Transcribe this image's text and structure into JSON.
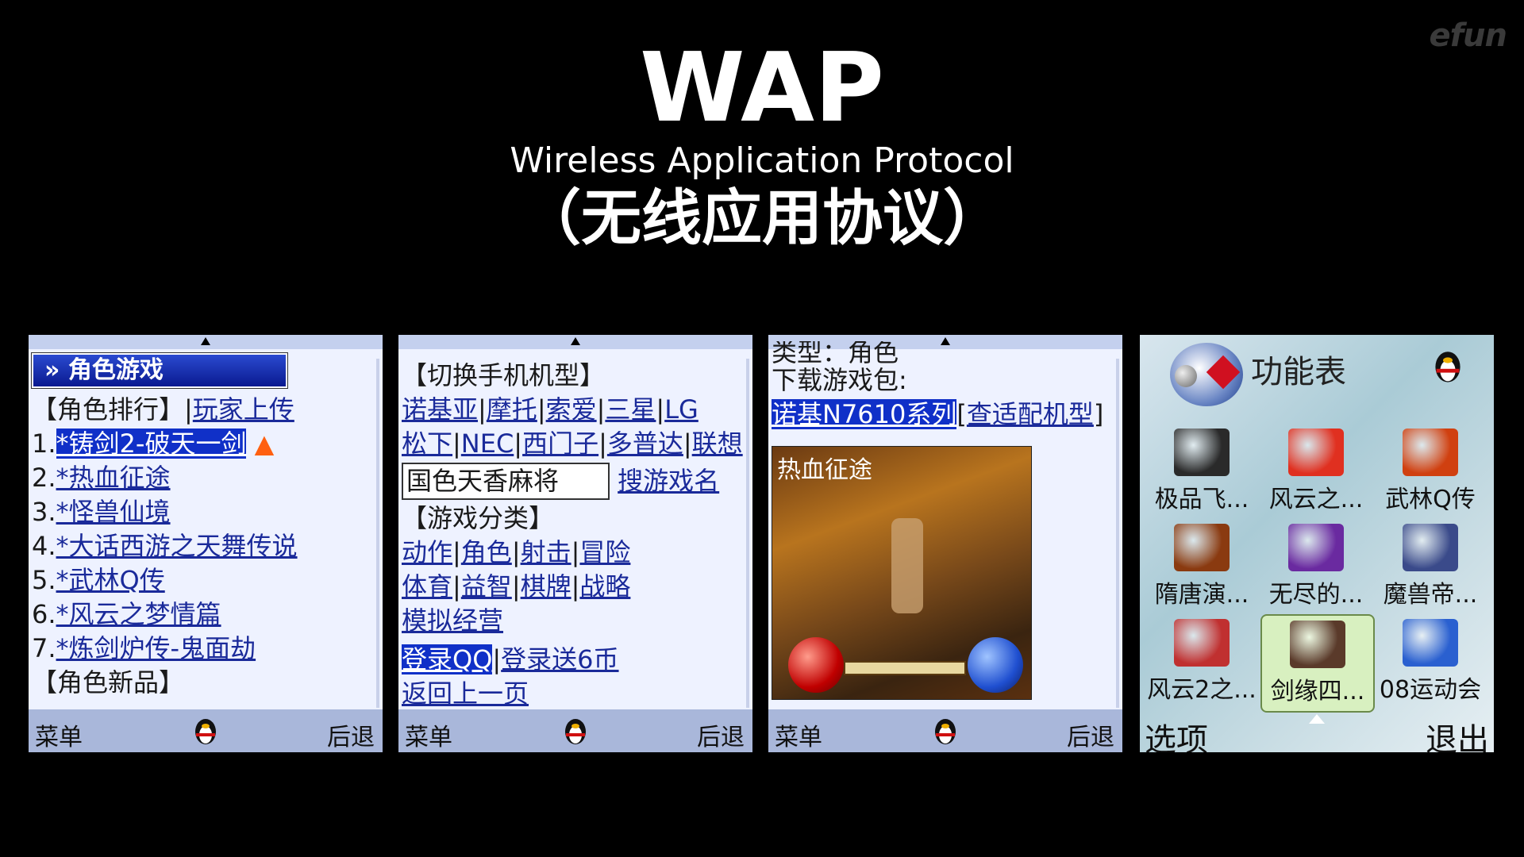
{
  "logo": "efun",
  "header": {
    "title": "WAP",
    "subtitle": "Wireless Application Protocol",
    "cn": "（无线应用协议）"
  },
  "softkeys": {
    "menu": "菜单",
    "back": "后退"
  },
  "phone1": {
    "header": "» 角色游戏",
    "ranking_label": "【角色排行】",
    "upload_link": "玩家上传",
    "items": [
      {
        "num": "1.",
        "text": "*铸剑2-破天一剑"
      },
      {
        "num": "2.",
        "text": "*热血征途"
      },
      {
        "num": "3.",
        "text": "*怪兽仙境"
      },
      {
        "num": "4.",
        "text": "*大话西游之天舞传说"
      },
      {
        "num": "5.",
        "text": "*武林Q传"
      },
      {
        "num": "6.",
        "text": "*风云之梦情篇"
      },
      {
        "num": "7.",
        "text": "*炼剑炉传-鬼面劫"
      }
    ],
    "new_label": "【角色新品】"
  },
  "phone2": {
    "switch_label": "【切换手机机型】",
    "brands_row1": [
      "诺基亚",
      "摩托",
      "索爱",
      "三星",
      "LG"
    ],
    "brands_row2": [
      "松下",
      "NEC",
      "西门子",
      "多普达",
      "联想"
    ],
    "search_value": "国色天香麻将",
    "search_button": "搜游戏名",
    "category_label": "【游戏分类】",
    "cats_row1": [
      "动作",
      "角色",
      "射击",
      "冒险"
    ],
    "cats_row2": [
      "体育",
      "益智",
      "棋牌",
      "战略"
    ],
    "cats_row3": [
      "模拟经营"
    ],
    "login_qq": "登录QQ",
    "login_gift": "登录送6币",
    "back_prev": "返回上一页"
  },
  "phone3": {
    "cut_text": "类型：角色",
    "download_label": "下载游戏包:",
    "model_selected": "诺基N7610系列",
    "model_link": "查适配机型",
    "game_title": "热血征途"
  },
  "phone4": {
    "title": "功能表",
    "items": [
      {
        "label": "极品飞...",
        "color": "#2a2a2a"
      },
      {
        "label": "风云之...",
        "color": "#e03020"
      },
      {
        "label": "武林Q传",
        "color": "#d04010"
      },
      {
        "label": "隋唐演...",
        "color": "#8a3a10"
      },
      {
        "label": "无尽的...",
        "color": "#6a2aa0"
      },
      {
        "label": "魔兽帝...",
        "color": "#3a4a8a"
      },
      {
        "label": "风云2之...",
        "color": "#c03030"
      },
      {
        "label": "剑缘四...",
        "color": "#5a3a2a"
      },
      {
        "label": "08运动会",
        "color": "#2a60d0"
      }
    ],
    "left_soft": "选项",
    "right_soft": "退出"
  }
}
